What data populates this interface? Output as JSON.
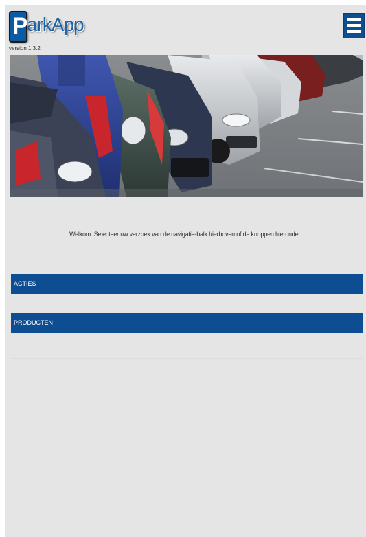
{
  "header": {
    "logo_letter": "P",
    "logo_text": "arkApp",
    "version": "version 1.3.2",
    "menu_icon": "hamburger-menu-icon"
  },
  "banner": {
    "image": "parked-cars-photo"
  },
  "main": {
    "welcome_text": "Welkom. Selecteer uw verzoek van de navigatie-balk hierboven of de knoppen hieronder.",
    "buttons": [
      {
        "label": "ACTIES"
      },
      {
        "label": "PRODUCTEN"
      }
    ]
  },
  "colors": {
    "brand_blue": "#0d4d91",
    "background": "#e5e5e5",
    "logo_text": "#1f63a8"
  }
}
